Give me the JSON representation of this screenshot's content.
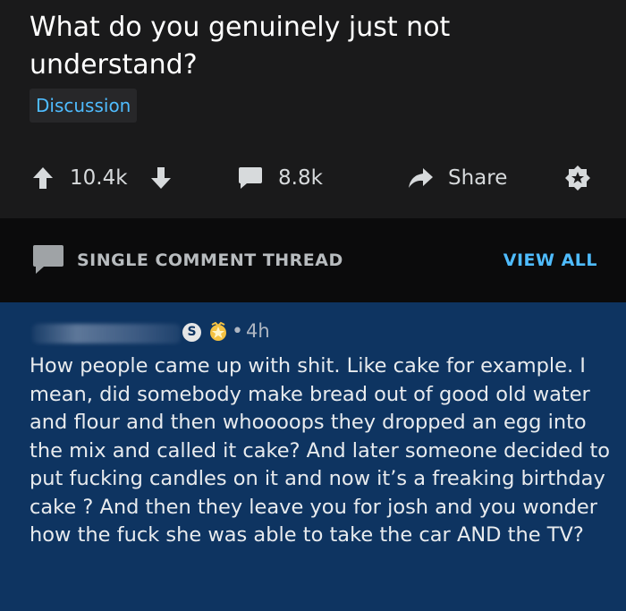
{
  "post": {
    "title": "What do you genuinely just not understand?",
    "flair": "Discussion",
    "actions": {
      "upvotes": "10.4k",
      "comments": "8.8k",
      "share": "Share"
    }
  },
  "thread_bar": {
    "label": "SINGLE COMMENT THREAD",
    "view_all": "VIEW ALL"
  },
  "comment": {
    "badge": "S",
    "time": "4h",
    "body": "How people came up with shit. Like cake for example. I mean, did somebody make bread out of good old water and flour and then whoooops they dropped an egg into the mix and called it cake? And later someone decided to put fucking candles on it and now it’s a freaking birthday cake ? And then they leave you for josh and you wonder how the fuck she was able to take the car AND the TV?"
  },
  "colors": {
    "post_bg": "#1a1a1b",
    "separator_bg": "#0b0b0c",
    "comment_bg": "#0e3461",
    "accent_blue": "#4fbcff",
    "award_gold": "#f5c242"
  },
  "icons": [
    "upvote-arrow-icon",
    "downvote-arrow-icon",
    "comment-bubble-icon",
    "share-arrow-icon",
    "award-icon",
    "thread-bubble-icon",
    "gold-award-icon"
  ]
}
